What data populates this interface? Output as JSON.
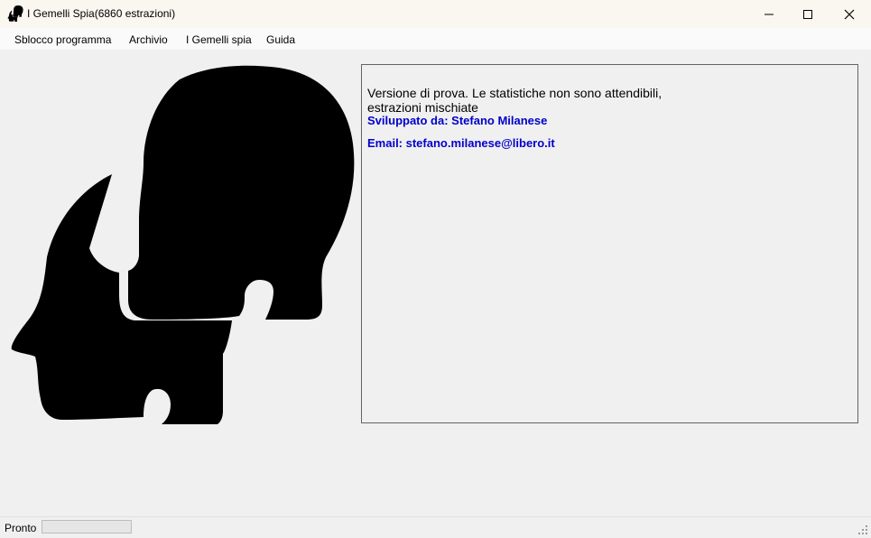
{
  "window": {
    "title": "I Gemelli Spia(6860 estrazioni)"
  },
  "menu": {
    "items": [
      "Sblocco programma",
      "Archivio",
      "I Gemelli spia",
      "Guida"
    ]
  },
  "info": {
    "line1": "Versione di prova. Le statistiche non sono attendibili,",
    "line2": "estrazioni mischiate",
    "developer": "Sviluppato da: Stefano Milanese",
    "email": "Email: stefano.milanese@libero.it"
  },
  "status": {
    "text": "Pronto",
    "progress": 0
  },
  "icons": {
    "app": "twin-heads-icon",
    "logo": "twin-heads-logo",
    "minimize": "minimize-icon",
    "maximize": "maximize-icon",
    "close": "close-icon",
    "grip": "resize-grip-icon"
  },
  "colors": {
    "link_text": "#0000cc",
    "window_bg": "#f0f0f0"
  }
}
